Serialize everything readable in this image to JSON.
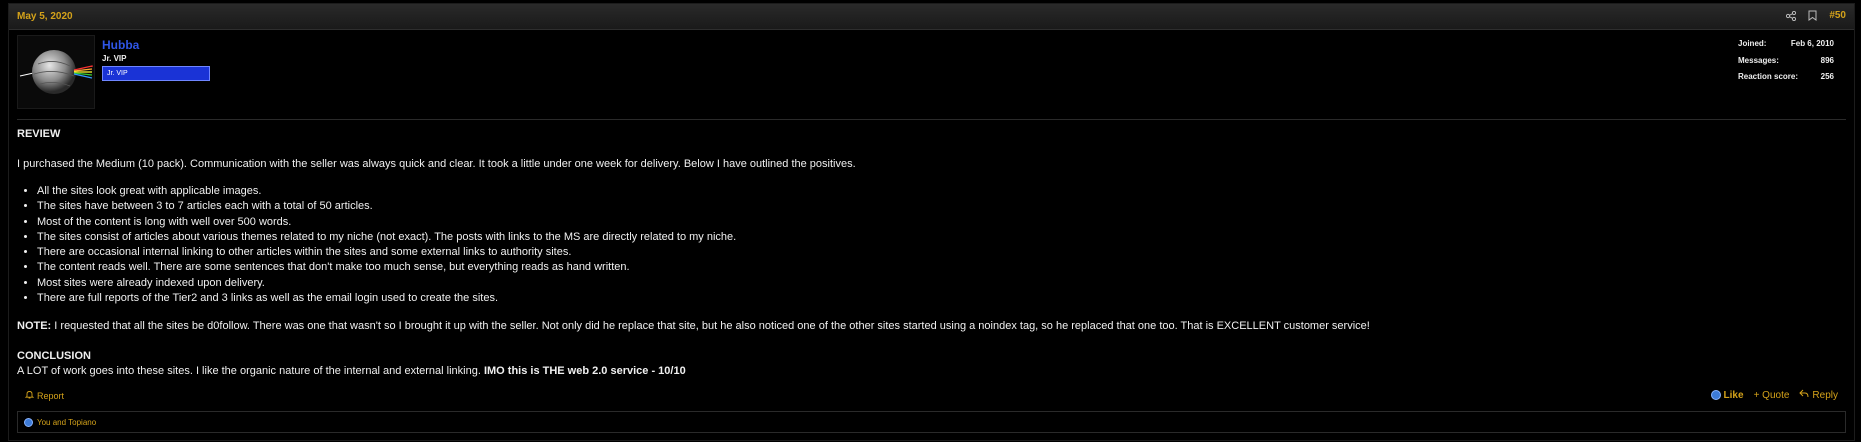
{
  "post": {
    "date": "May 5, 2020",
    "number": "#50",
    "icons": {
      "share": "share-icon",
      "bookmark": "bookmark-icon"
    }
  },
  "author": {
    "username": "Hubba",
    "title": "Jr. VIP",
    "banner": "Jr. VIP",
    "avatar_icon": "avatar-sphere-prism"
  },
  "stats": [
    {
      "label": "Joined:",
      "value": "Feb 6, 2010"
    },
    {
      "label": "Messages:",
      "value": "896"
    },
    {
      "label": "Reaction score:",
      "value": "256"
    }
  ],
  "body": {
    "review_heading": "REVIEW",
    "intro": "I purchased the Medium (10 pack). Communication with the seller was always quick and clear. It took a little under one week for delivery. Below I have outlined the positives.",
    "bullets": [
      "All the sites look great with applicable images.",
      "The sites have between 3 to 7 articles each with a total of 50 articles.",
      "Most of the content is long with well over 500 words.",
      "The sites consist of articles about various themes related to my niche (not exact). The posts with links to the MS are directly related to my niche.",
      "There are occasional internal linking to other articles within the sites and some external links to authority sites.",
      "The content reads well. There are some sentences that don't make too much sense, but everything reads as hand written.",
      "Most sites were already indexed upon delivery.",
      "There are full reports of the Tier2 and 3 links as well as the email login used to create the sites."
    ],
    "note_label": "NOTE:",
    "note_text": " I requested that all the sites be d0follow. There was one that wasn't so I brought it up with the seller. Not only did he replace that site, but he also noticed one of the other sites started using a noindex tag, so he replaced that one too. That is EXCELLENT customer service!",
    "conclusion_heading": "CONCLUSION",
    "conclusion_text": "A LOT of work goes into these sites. I like the organic nature of the internal and external linking. ",
    "conclusion_bold": "IMO this is THE web 2.0 service - 10/10"
  },
  "actions": {
    "report": "Report",
    "like": "Like",
    "quote": "+ Quote",
    "reply": "Reply"
  },
  "reactions": {
    "text": "You and Topiano"
  },
  "colors": {
    "accent": "#d4a21a",
    "username": "#2f56e8",
    "banner": "#1a33d6",
    "like": "#3d7bd8"
  }
}
